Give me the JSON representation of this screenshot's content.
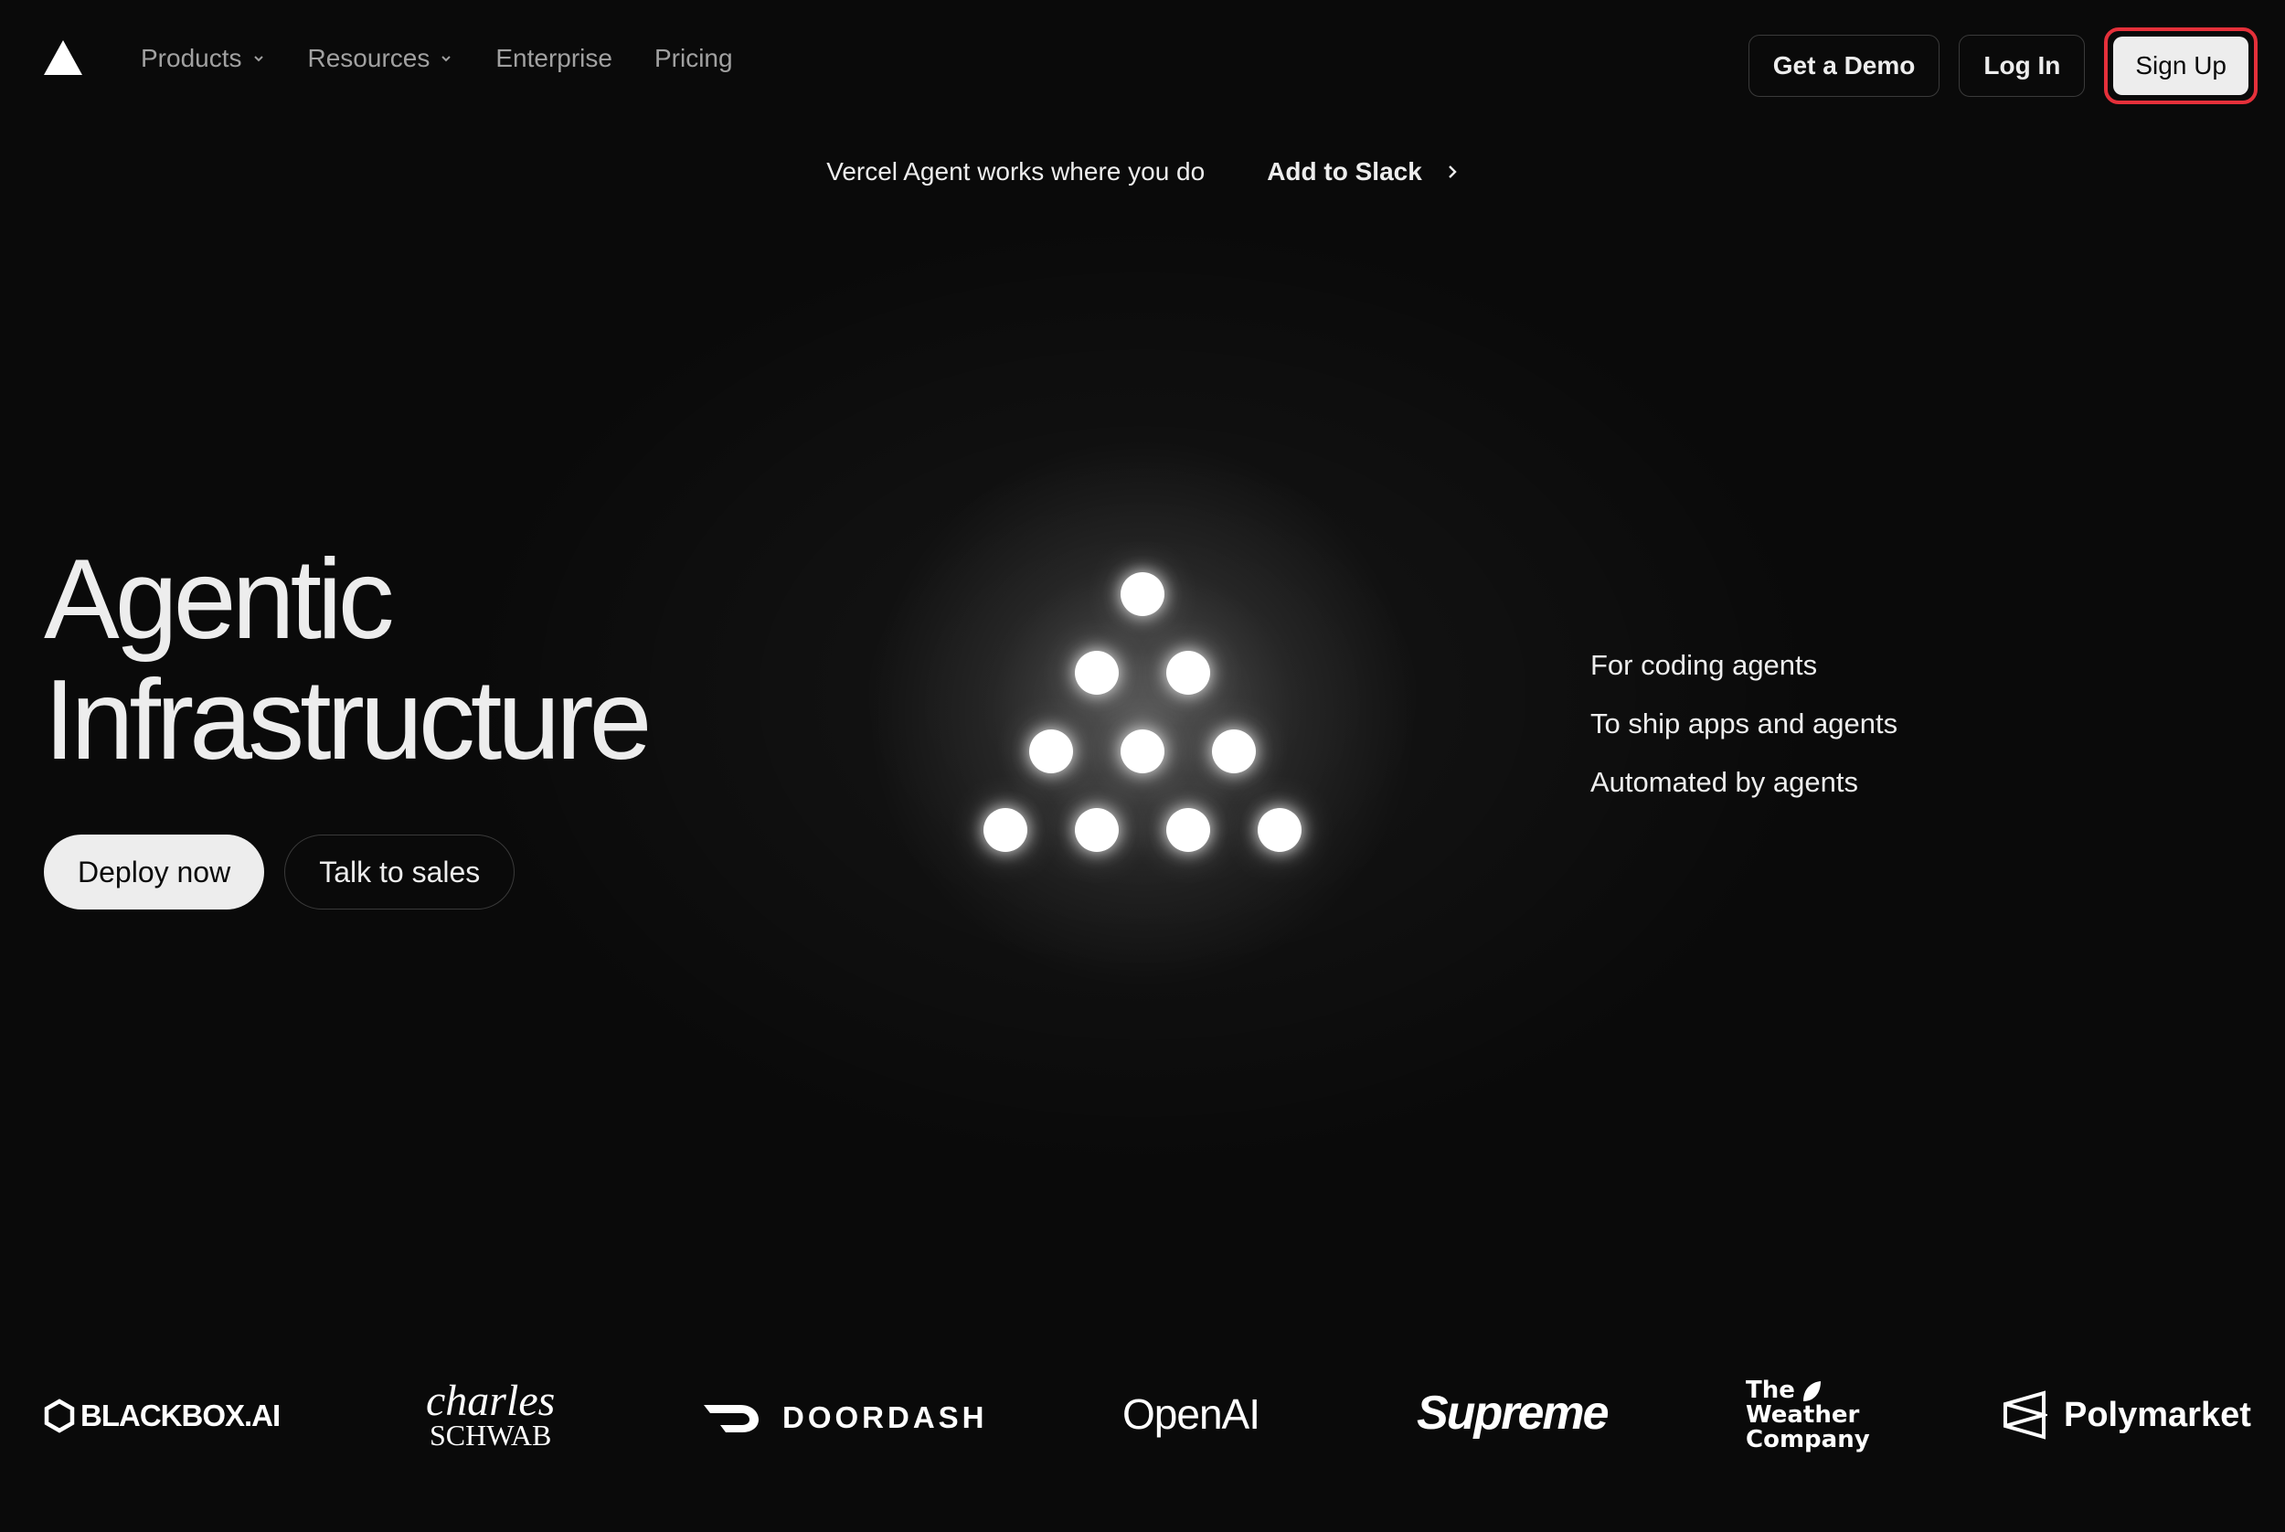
{
  "nav": {
    "links": [
      {
        "label": "Products",
        "has_dropdown": true
      },
      {
        "label": "Resources",
        "has_dropdown": true
      },
      {
        "label": "Enterprise",
        "has_dropdown": false
      },
      {
        "label": "Pricing",
        "has_dropdown": false
      }
    ],
    "get_demo": "Get a Demo",
    "log_in": "Log In",
    "sign_up": "Sign Up"
  },
  "announcement": {
    "text": "Vercel Agent works where you do",
    "link": "Add to Slack"
  },
  "hero": {
    "title_line1": "Agentic",
    "title_line2": "Infrastructure",
    "deploy": "Deploy now",
    "sales": "Talk to sales"
  },
  "taglines": [
    "For coding agents",
    "To ship apps and agents",
    "Automated by agents"
  ],
  "logos": {
    "blackbox": "BLACKBOX.AI",
    "schwab_top": "charles",
    "schwab_bottom": "SCHWAB",
    "doordash": "DOORDASH",
    "openai": "OpenAI",
    "supreme": "Supreme",
    "weather_1": "The",
    "weather_2": "Weather",
    "weather_3": "Company",
    "polymarket": "Polymarket"
  },
  "colors": {
    "background": "#0a0a0a",
    "highlight": "#e5303a",
    "button_light": "#ededed"
  }
}
